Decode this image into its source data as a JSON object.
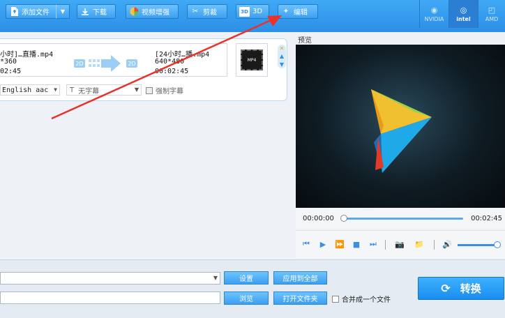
{
  "toolbar": {
    "add_file": "添加文件",
    "download": "下载",
    "video_enhance": "视频增强",
    "cut": "剪裁",
    "three_d": "3D",
    "edit": "编辑"
  },
  "hw_accel": [
    "NVIDIA",
    "intel",
    "AMD"
  ],
  "file": {
    "src_name": "小时]…直播.mp4",
    "src_res": "*360",
    "src_dur": "02:45",
    "dst_name": "[24小时…播.mp4",
    "dst_res": "640*480",
    "dst_dur": "00:02:45",
    "badge_src": "2D",
    "badge_dst": "2D",
    "audio_track": "English aac",
    "subtitle": "无字幕",
    "force_subtitle": "强制字幕"
  },
  "preview": {
    "label": "预览",
    "time_start": "00:00:00",
    "time_end": "00:02:45"
  },
  "bottom": {
    "settings": "设置",
    "apply_all": "应用到全部",
    "browse": "浏览",
    "open_folder": "打开文件夹",
    "merge": "合并成一个文件",
    "convert": "转换"
  },
  "colors": {
    "accent": "#2c8fe6",
    "annotation_arrow": "#e8322b"
  }
}
